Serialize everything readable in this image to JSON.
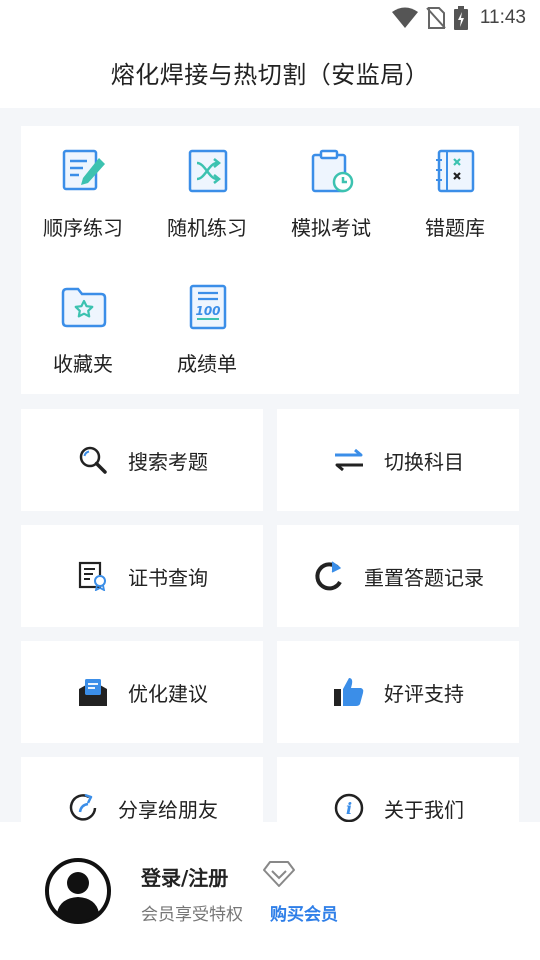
{
  "status_bar": {
    "time": "11:43"
  },
  "app_bar": {
    "title": "熔化焊接与热切割（安监局）"
  },
  "practice_grid": [
    {
      "label": "顺序练习",
      "icon": "edit-document-icon"
    },
    {
      "label": "随机练习",
      "icon": "shuffle-icon"
    },
    {
      "label": "模拟考试",
      "icon": "clipboard-clock-icon"
    },
    {
      "label": "错题库",
      "icon": "wrong-notebook-icon"
    },
    {
      "label": "收藏夹",
      "icon": "star-folder-icon"
    },
    {
      "label": "成绩单",
      "icon": "score-sheet-icon"
    }
  ],
  "tiles": [
    {
      "label": "搜索考题",
      "icon": "search-icon"
    },
    {
      "label": "切换科目",
      "icon": "switch-arrows-icon"
    },
    {
      "label": "证书查询",
      "icon": "certificate-icon"
    },
    {
      "label": "重置答题记录",
      "icon": "reset-icon"
    },
    {
      "label": "优化建议",
      "icon": "feedback-mail-icon"
    },
    {
      "label": "好评支持",
      "icon": "thumbs-up-icon"
    },
    {
      "label": "分享给朋友",
      "icon": "share-refresh-icon"
    },
    {
      "label": "关于我们",
      "icon": "info-icon"
    }
  ],
  "profile": {
    "login_label": "登录/注册",
    "member_text": "会员享受特权",
    "buy_label": "购买会员"
  },
  "colors": {
    "accent": "#2f7fe8",
    "icon_blue": "#3b8ee8",
    "icon_teal": "#3cc2b0"
  }
}
